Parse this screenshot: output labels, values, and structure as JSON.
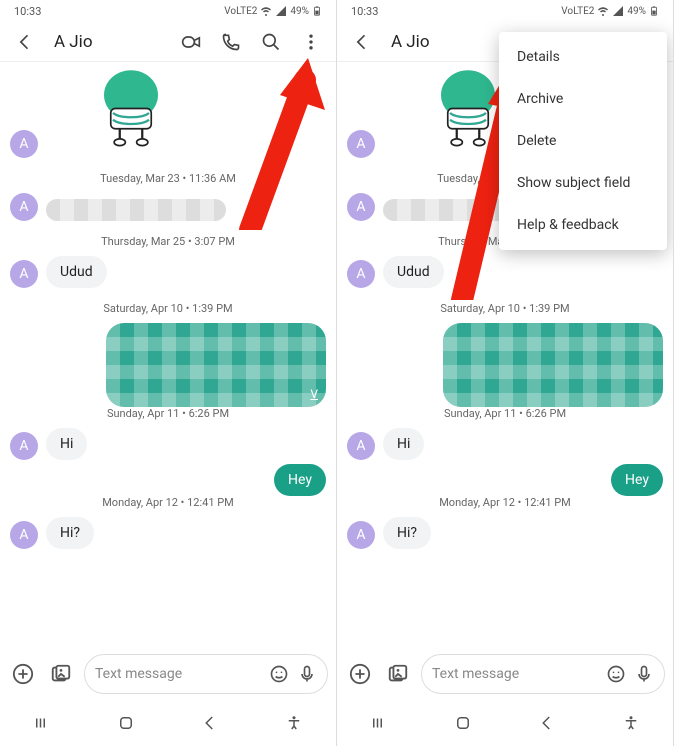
{
  "status": {
    "time": "10:33",
    "battery": "49%",
    "net": "VoLTE2"
  },
  "contact": "A Jio",
  "avatar_letter": "A",
  "timestamps": {
    "t1": "Tuesday, Mar 23 • 11:36 AM",
    "t2": "Thursday, Mar 25 • 3:07 PM",
    "t3": "Saturday, Apr 10 • 1:39 PM",
    "t4": "Sunday, Apr 11 • 6:26 PM",
    "t5": "Monday, Apr 12 • 12:41 PM"
  },
  "msg": {
    "udud": "Udud",
    "hi": "Hi",
    "hey": "Hey",
    "hi2": "Hi?",
    "v": "V"
  },
  "compose": {
    "placeholder": "Text message"
  },
  "menu": {
    "details": "Details",
    "archive": "Archive",
    "delete": "Delete",
    "subject": "Show subject field",
    "help": "Help & feedback"
  }
}
